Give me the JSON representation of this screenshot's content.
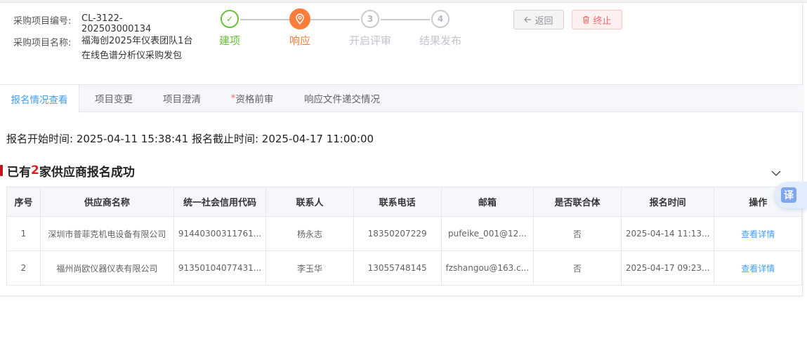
{
  "header": {
    "project_no_label": "采购项目编号:",
    "project_no": "CL-3122-202503000134",
    "project_name_label": "采购项目名称:",
    "project_name": "福海创2025年仪表团队1台在线色谱分析仪采购发包"
  },
  "steps": [
    {
      "num": "✓",
      "label": "建项",
      "status": "done"
    },
    {
      "num": "",
      "label": "响应",
      "status": "active"
    },
    {
      "num": "3",
      "label": "开启评审",
      "status": "pending"
    },
    {
      "num": "4",
      "label": "结果发布",
      "status": "pending"
    }
  ],
  "actions": {
    "back_label": "返回",
    "stop_label": "终止"
  },
  "tabs": [
    {
      "label": "报名情况查看",
      "active": true
    },
    {
      "label": "项目变更",
      "active": false
    },
    {
      "label": "项目澄清",
      "active": false
    },
    {
      "label": "资格前审",
      "required": true,
      "active": false
    },
    {
      "label": "响应文件递交情况",
      "active": false
    }
  ],
  "timing": {
    "start_label": "报名开始时间:",
    "start_value": "2025-04-11 15:38:41",
    "end_label": "报名截止时间:",
    "end_value": "2025-04-17 11:00:00"
  },
  "section": {
    "prefix": "已有",
    "count": "2",
    "suffix": "家供应商报名成功"
  },
  "table": {
    "columns": [
      "序号",
      "供应商名称",
      "统一社会信用代码",
      "联系人",
      "联系电话",
      "邮箱",
      "是否联合体",
      "报名时间",
      "操作"
    ],
    "rows": [
      {
        "index": "1",
        "supplier": "深圳市普菲克机电设备有限公司",
        "credit_code": "91440300311761...",
        "contact": "杨永志",
        "phone": "18350207229",
        "email": "pufeike_001@12...",
        "consortium": "否",
        "signup_time": "2025-04-14 11:13...",
        "action": "查看详情"
      },
      {
        "index": "2",
        "supplier": "福州尚欧仪器仪表有限公司",
        "credit_code": "91350104077431...",
        "contact": "李玉华",
        "phone": "13055748145",
        "email": "fzshangou@163.c...",
        "consortium": "否",
        "signup_time": "2025-04-17 09:23...",
        "action": "查看详情"
      }
    ]
  },
  "float_translate": "译",
  "colors": {
    "primary": "#409eff",
    "done": "#67c23a",
    "active": "#ff7d3b",
    "danger": "#f56c6c"
  }
}
